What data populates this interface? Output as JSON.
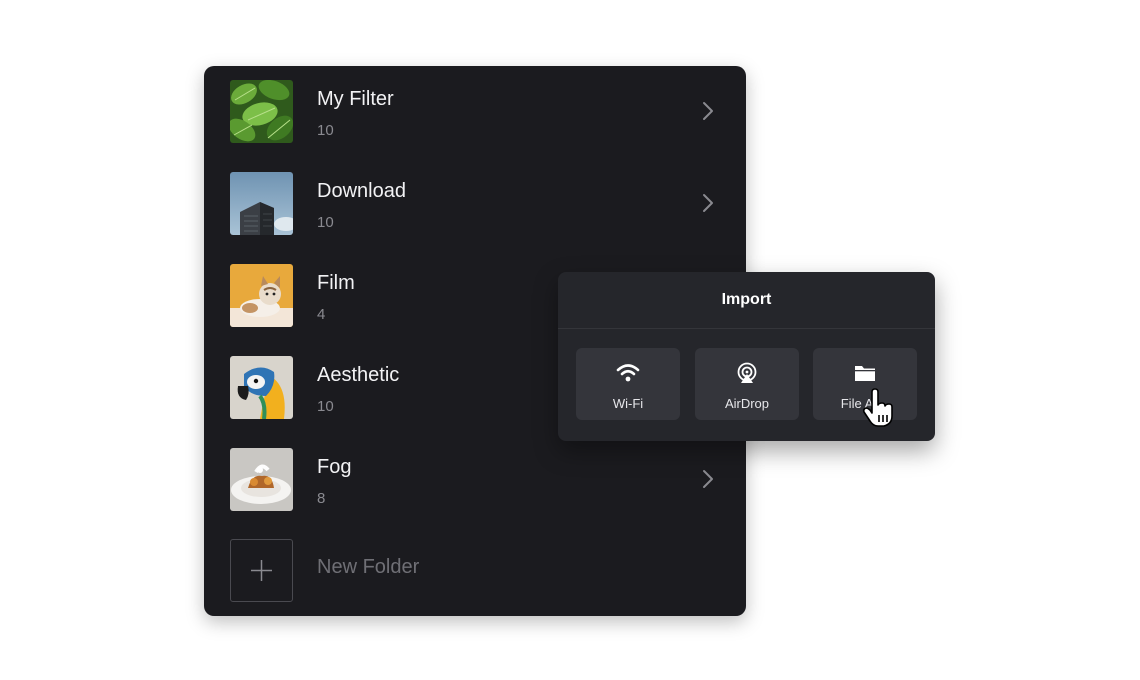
{
  "folders": [
    {
      "title": "My Filter",
      "count": "10",
      "thumb": "leaves-photo",
      "has_chevron": true
    },
    {
      "title": "Download",
      "count": "10",
      "thumb": "building-photo",
      "has_chevron": true
    },
    {
      "title": "Film",
      "count": "4",
      "thumb": "kitten-photo",
      "has_chevron": false
    },
    {
      "title": "Aesthetic",
      "count": "10",
      "thumb": "parrot-photo",
      "has_chevron": false
    },
    {
      "title": "Fog",
      "count": "8",
      "thumb": "food-photo",
      "has_chevron": true
    }
  ],
  "new_folder": {
    "label": "New Folder",
    "icon": "plus-icon"
  },
  "import_popup": {
    "title": "Import",
    "options": [
      {
        "label": "Wi-Fi",
        "icon": "wifi-icon"
      },
      {
        "label": "AirDrop",
        "icon": "airdrop-icon"
      },
      {
        "label": "File A",
        "icon": "folder-icon"
      }
    ]
  },
  "colors": {
    "panel_bg": "#1b1b1f",
    "popup_bg": "#25262b",
    "option_bg": "#34353b",
    "text_primary": "#f2f2f4",
    "text_secondary": "#8a8a90"
  }
}
